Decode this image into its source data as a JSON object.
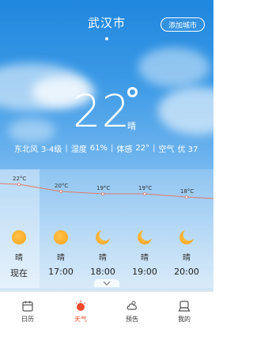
{
  "header": {
    "city": "武汉市",
    "add_city_label": "添加城市"
  },
  "current": {
    "temperature": "22",
    "condition": "晴"
  },
  "details": {
    "wind_label": "东北风",
    "wind_value": "3-4级",
    "humidity_label": "湿度",
    "humidity_value": "61%",
    "feels_label": "体感",
    "feels_value": "22°",
    "air_label": "空气",
    "air_value": "优 37",
    "separator": "|"
  },
  "hourly": [
    {
      "time": "现在",
      "condition": "晴",
      "icon": "sun-icon",
      "temp_label": "22°C",
      "temp": 22
    },
    {
      "time": "17:00",
      "condition": "晴",
      "icon": "sun-icon",
      "temp_label": "20°C",
      "temp": 20
    },
    {
      "time": "18:00",
      "condition": "晴",
      "icon": "moon-icon",
      "temp_label": "19°C",
      "temp": 19
    },
    {
      "time": "19:00",
      "condition": "晴",
      "icon": "moon-icon",
      "temp_label": "19°C",
      "temp": 19
    },
    {
      "time": "20:00",
      "condition": "晴",
      "icon": "moon-icon",
      "temp_label": "18°C",
      "temp": 18
    }
  ],
  "tabs": [
    {
      "label": "日历",
      "icon": "calendar-icon",
      "active": false
    },
    {
      "label": "天气",
      "icon": "weather-icon",
      "active": true
    },
    {
      "label": "预告",
      "icon": "forecast-icon",
      "active": false
    },
    {
      "label": "我的",
      "icon": "profile-icon",
      "active": false
    }
  ],
  "colors": {
    "accent": "#f04a2c",
    "curve": "#e07a6a",
    "sun": "#f7a21b"
  }
}
